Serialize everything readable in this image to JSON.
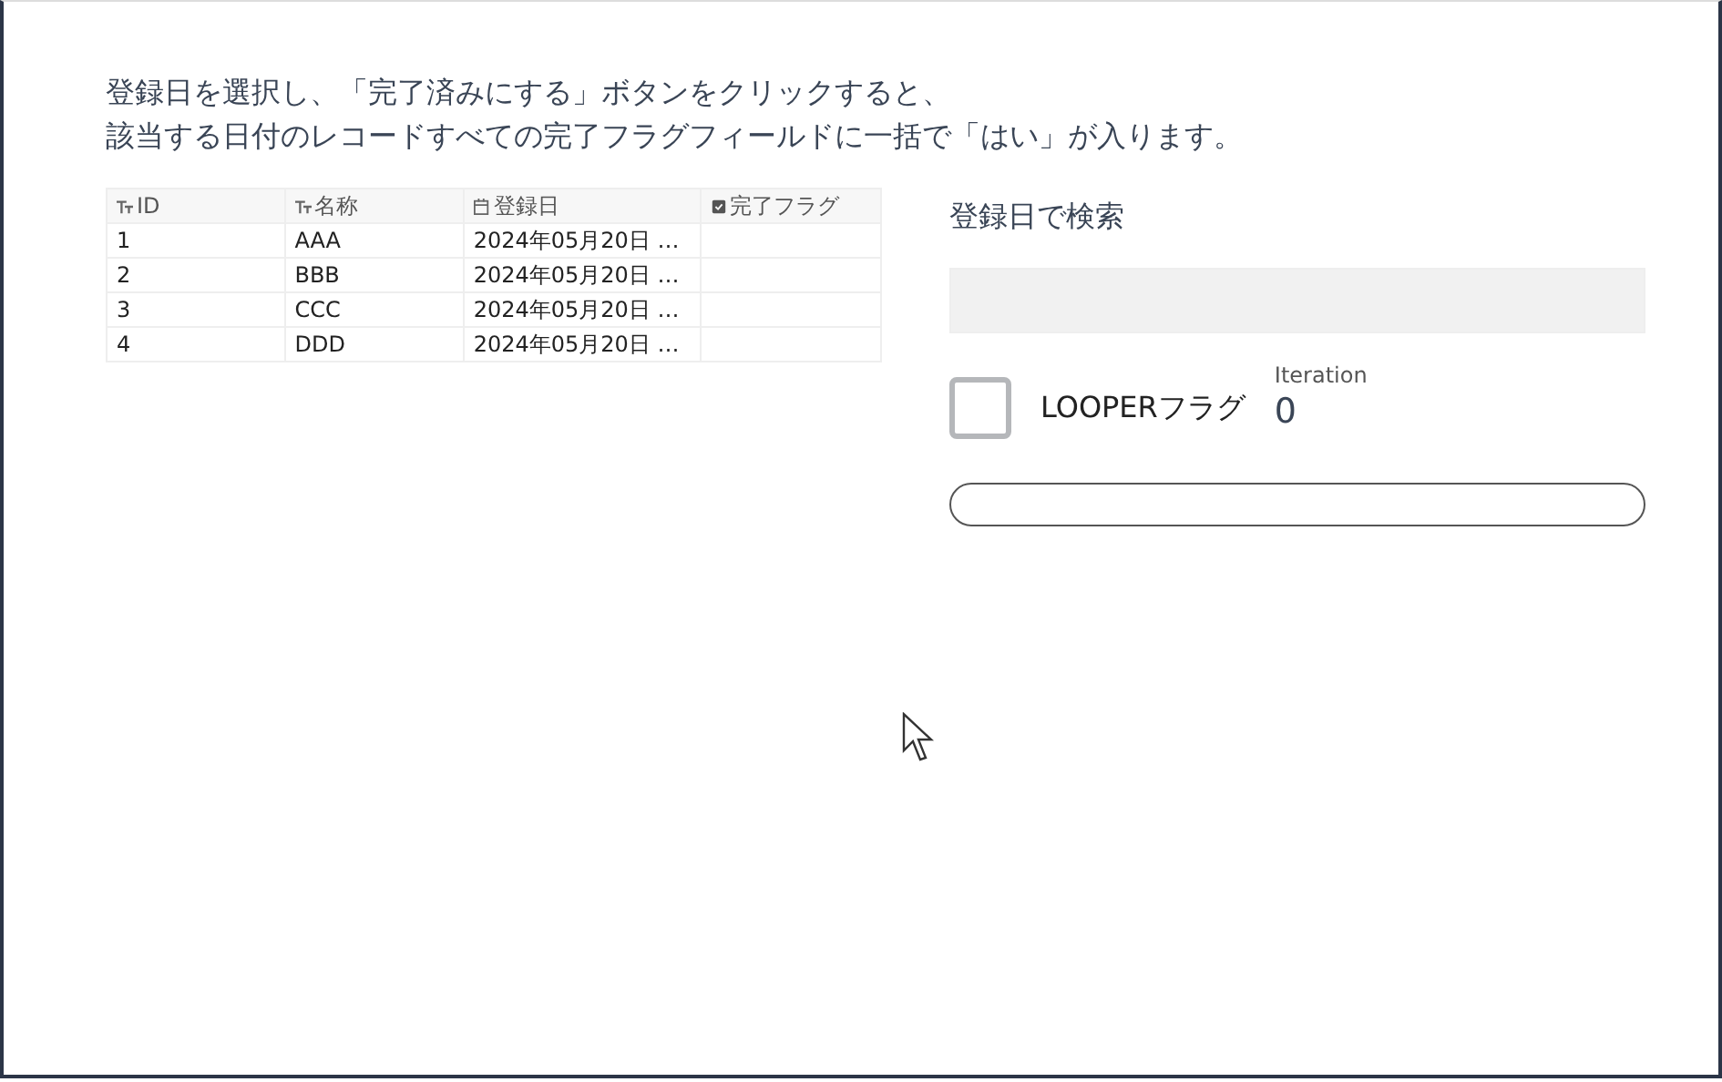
{
  "instructions": [
    "登録日を選択し、「完了済みにする」ボタンをクリックすると、",
    "該当する日付のレコードすべての完了フラグフィールドに一括で「はい」が入ります。"
  ],
  "table": {
    "columns": [
      {
        "label": "ID",
        "kind": "text"
      },
      {
        "label": "名称",
        "kind": "text"
      },
      {
        "label": "登録日",
        "kind": "date"
      },
      {
        "label": "完了フラグ",
        "kind": "check"
      }
    ],
    "rows": [
      [
        "1",
        "AAA",
        "2024年05月20日 …",
        ""
      ],
      [
        "2",
        "BBB",
        "2024年05月20日 …",
        ""
      ],
      [
        "3",
        "CCC",
        "2024年05月20日 …",
        ""
      ],
      [
        "4",
        "DDD",
        "2024年05月20日 …",
        ""
      ]
    ]
  },
  "search": {
    "label": "登録日で検索"
  },
  "looper": {
    "label": "LOOPERフラグ",
    "checked": false
  },
  "iteration": {
    "label": "Iteration",
    "value": "0"
  }
}
